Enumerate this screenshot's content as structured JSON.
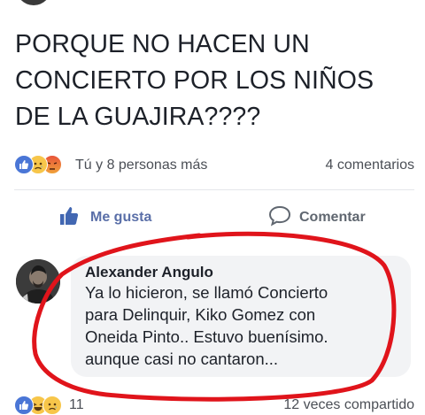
{
  "post": {
    "text": "PORQUE NO HACEN UN\nCONCIERTO POR LOS NIÑOS\nDE LA GUAJIRA????"
  },
  "reactions": {
    "summary_text": "Tú y 8 personas más",
    "comments_count": "4 comentarios",
    "icons": [
      "like-icon",
      "sad-icon",
      "angry-icon"
    ]
  },
  "actions": {
    "like_label": "Me gusta",
    "comment_label": "Comentar"
  },
  "comment": {
    "author": "Alexander Angulo",
    "text": "Ya lo hicieron, se llamó Concierto\npara Delinquir, Kiko Gomez con\nOneida Pinto.. Estuvo buenísimo.\naunque casi no cantaron...",
    "reaction_icons": [
      "like-icon",
      "haha-icon",
      "sad-icon"
    ],
    "reaction_count": "11",
    "shares": "12 veces compartido"
  },
  "colors": {
    "like_blue": "#4267b2",
    "annotation_red": "#e0141b",
    "bubble_gray": "#f2f3f5"
  }
}
